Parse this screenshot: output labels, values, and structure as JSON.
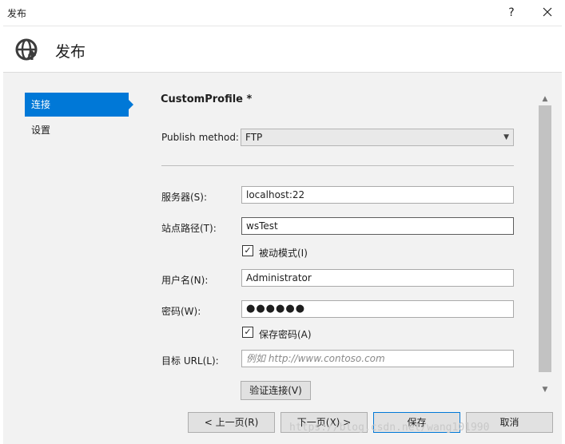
{
  "window": {
    "title": "发布",
    "help_glyph": "?",
    "close_glyph": "✕"
  },
  "header": {
    "title": "发布",
    "icon": "globe-upload-icon"
  },
  "nav": {
    "items": [
      {
        "label": "连接",
        "active": true
      },
      {
        "label": "设置",
        "active": false
      }
    ]
  },
  "main": {
    "profile_title": "CustomProfile *",
    "publish_method_label": "Publish method:",
    "publish_method_value": "FTP",
    "server_label": "服务器(S):",
    "server_value": "localhost:22",
    "site_path_label": "站点路径(T):",
    "site_path_value": "wsTest",
    "passive_mode_label": "被动模式(I)",
    "passive_mode_checked": true,
    "username_label": "用户名(N):",
    "username_value": "Administrator",
    "password_label": "密码(W):",
    "password_value": "●●●●●●",
    "save_password_label": "保存密码(A)",
    "save_password_checked": true,
    "target_url_label": "目标 URL(L):",
    "target_url_placeholder": "例如 http://www.contoso.com",
    "verify_button": "验证连接(V)"
  },
  "footer": {
    "prev": "< 上一页(R)",
    "next": "下一页(X) >",
    "save": "保存",
    "cancel": "取消"
  },
  "watermark": "https://blog.csdn.net/wang101990",
  "colors": {
    "accent": "#0078d7",
    "panel_bg": "#f2f2f2"
  }
}
